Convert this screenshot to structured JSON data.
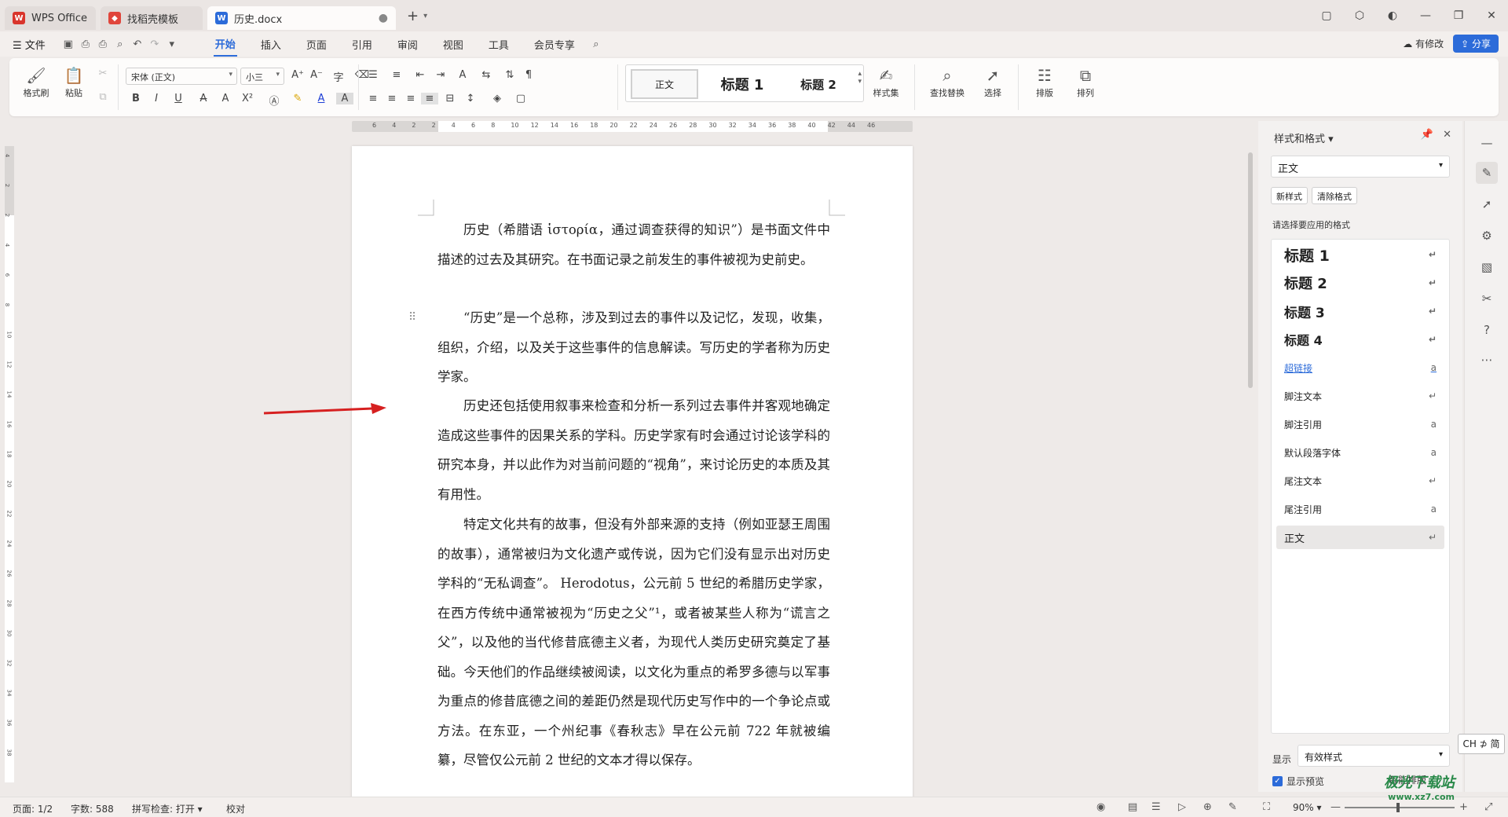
{
  "tabs": [
    {
      "label": "WPS Office",
      "icon": "wps-logo-icon"
    },
    {
      "label": "找稻壳模板",
      "icon": "docer-icon"
    },
    {
      "label": "历史.docx",
      "icon": "word-doc-icon"
    }
  ],
  "menu": {
    "file": "☰ 文件",
    "items": [
      "开始",
      "插入",
      "页面",
      "引用",
      "审阅",
      "视图",
      "工具",
      "会员专享"
    ],
    "active": "开始",
    "changed_label": "有修改",
    "share_label": "分享"
  },
  "ribbon": {
    "format_painter": "格式刷",
    "paste": "粘贴",
    "font_name": "宋体 (正文)",
    "font_size": "小三",
    "styles_gallery": [
      "正文",
      "标题 1",
      "标题 2"
    ],
    "style_set": "样式集",
    "find_replace": "查找替换",
    "select": "选择",
    "layout": "排版",
    "arrange": "排列"
  },
  "ruler": {
    "h_numbers": [
      "6",
      "4",
      "2",
      "2",
      "4",
      "6",
      "8",
      "10",
      "12",
      "14",
      "16",
      "18",
      "20",
      "22",
      "24",
      "26",
      "28",
      "30",
      "32",
      "34",
      "36",
      "38",
      "40",
      "42",
      "44",
      "46"
    ],
    "v_numbers": [
      "4",
      "2",
      "2",
      "4",
      "6",
      "8",
      "10",
      "12",
      "14",
      "16",
      "18",
      "20",
      "22",
      "24",
      "26",
      "28",
      "30",
      "32",
      "34",
      "36",
      "38"
    ]
  },
  "document": {
    "paragraphs": [
      "历史（希腊语 ἱστορία，通过调查获得的知识”）是书面文件中描述的过去及其研究。在书面记录之前发生的事件被视为史前史。",
      "“历史”是一个总称，涉及到过去的事件以及记忆，发现，收集，组织，介绍，以及关于这些事件的信息解读。写历史的学者称为历史学家。",
      "历史还包括使用叙事来检查和分析一系列过去事件并客观地确定造成这些事件的因果关系的学科。历史学家有时会通过讨论该学科的研究本身，并以此作为对当前问题的“视角”，来讨论历史的本质及其有用性。",
      "特定文化共有的故事，但没有外部来源的支持（例如亚瑟王周围的故事），通常被归为文化遗产或传说，因为它们没有显示出对历史学科的“无私调查”。 Herodotus，公元前 5 世纪的希腊历史学家，在西方传统中通常被视为“历史之父”¹，或者被某些人称为“谎言之父”，以及他的当代修昔底德主义者，为现代人类历史研究奠定了基础。今天他们的作品继续被阅读，以文化为重点的希罗多德与以军事为重点的修昔底德之间的差距仍然是现代历史写作中的一个争论点或方法。在东亚，一个州纪事《春秋志》早在公元前 722 年就被编纂，尽管仅公元前 2 世纪的文本才得以保存。"
    ]
  },
  "side_panel": {
    "title": "样式和格式",
    "current_style": "正文",
    "new_style": "新样式",
    "clear_format": "清除格式",
    "apply_label": "请选择要应用的格式",
    "styles": [
      {
        "name": "标题 1",
        "mark": "↵"
      },
      {
        "name": "标题 2",
        "mark": "↵"
      },
      {
        "name": "标题 3",
        "mark": "↵"
      },
      {
        "name": "标题 4",
        "mark": "↵"
      },
      {
        "name": "超链接",
        "mark": "a"
      },
      {
        "name": "脚注文本",
        "mark": "↵"
      },
      {
        "name": "脚注引用",
        "mark": "a"
      },
      {
        "name": "默认段落字体",
        "mark": "a"
      },
      {
        "name": "尾注文本",
        "mark": "↵"
      },
      {
        "name": "尾注引用",
        "mark": "a"
      },
      {
        "name": "正文",
        "mark": "↵"
      }
    ],
    "show_label": "显示",
    "show_value": "有效样式",
    "preview_label": "显示预览",
    "smart_layout": "智能排版"
  },
  "ime": "CH ⊅ 简",
  "status": {
    "page": "页面: 1/2",
    "words": "字数: 588",
    "spellcheck": "拼写检查: 打开",
    "proofread": "校对",
    "zoom": "90%"
  },
  "watermark": {
    "title": "极光下载站",
    "url": "www.xz7.com"
  },
  "colors": {
    "accent": "#2c6bd9",
    "arrow": "#d62020"
  }
}
